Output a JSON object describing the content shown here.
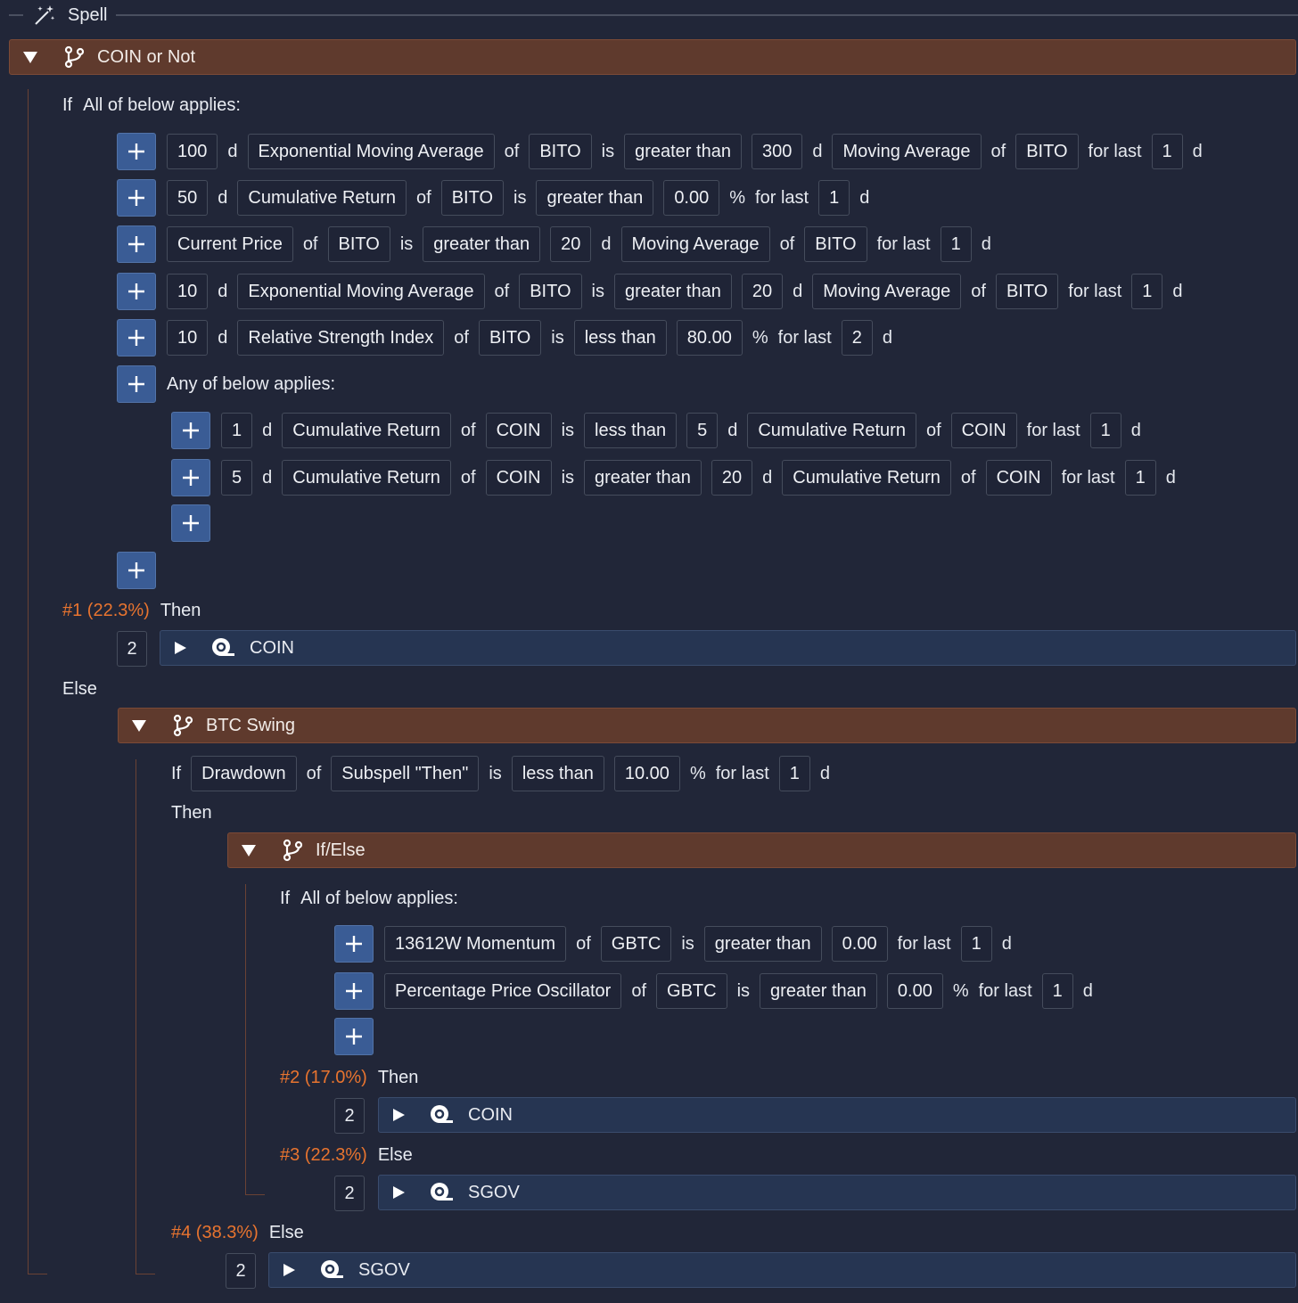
{
  "top": {
    "title": "Spell",
    "icon": "magic-wand-icon"
  },
  "main": {
    "header": "COIN or Not",
    "if_label": "If",
    "all_label": "All of below applies:",
    "rows": [
      [
        "100",
        "d",
        "Exponential Moving Average",
        "of",
        "BITO",
        "is",
        "greater than",
        "300",
        "d",
        "Moving Average",
        "of",
        "BITO",
        "for last",
        "1",
        "d"
      ],
      [
        "50",
        "d",
        "Cumulative Return",
        "of",
        "BITO",
        "is",
        "greater than",
        "0.00",
        "%",
        "for last",
        "1",
        "d"
      ],
      [
        "Current Price",
        "of",
        "BITO",
        "is",
        "greater than",
        "20",
        "d",
        "Moving Average",
        "of",
        "BITO",
        "for last",
        "1",
        "d"
      ],
      [
        "10",
        "d",
        "Exponential Moving Average",
        "of",
        "BITO",
        "is",
        "greater than",
        "20",
        "d",
        "Moving Average",
        "of",
        "BITO",
        "for last",
        "1",
        "d"
      ],
      [
        "10",
        "d",
        "Relative Strength Index",
        "of",
        "BITO",
        "is",
        "less than",
        "80.00",
        "%",
        "for last",
        "2",
        "d"
      ]
    ],
    "any_label": "Any of below applies:",
    "any_rows": [
      [
        "1",
        "d",
        "Cumulative Return",
        "of",
        "COIN",
        "is",
        "less than",
        "5",
        "d",
        "Cumulative Return",
        "of",
        "COIN",
        "for last",
        "1",
        "d"
      ],
      [
        "5",
        "d",
        "Cumulative Return",
        "of",
        "COIN",
        "is",
        "greater than",
        "20",
        "d",
        "Cumulative Return",
        "of",
        "COIN",
        "for last",
        "1",
        "d"
      ]
    ],
    "then1": {
      "pct": "#1 (22.3%)",
      "label": "Then",
      "weight": "2",
      "ticker": "COIN"
    },
    "else_label": "Else"
  },
  "btc": {
    "header": "BTC Swing",
    "if_label": "If",
    "cond": [
      "Drawdown",
      "of",
      "Subspell \"Then\"",
      "is",
      "less than",
      "10.00",
      "%",
      "for last",
      "1",
      "d"
    ],
    "then_label": "Then",
    "else4": {
      "pct": "#4 (38.3%)",
      "label": "Else",
      "weight": "2",
      "ticker": "SGOV"
    }
  },
  "ifelse": {
    "header": "If/Else",
    "if_label": "If",
    "all_label": "All of below applies:",
    "rows": [
      [
        "13612W Momentum",
        "of",
        "GBTC",
        "is",
        "greater than",
        "0.00",
        "for last",
        "1",
        "d"
      ],
      [
        "Percentage Price Oscillator",
        "of",
        "GBTC",
        "is",
        "greater than",
        "0.00",
        "%",
        "for last",
        "1",
        "d"
      ]
    ],
    "then2": {
      "pct": "#2 (17.0%)",
      "label": "Then",
      "weight": "2",
      "ticker": "COIN"
    },
    "else3": {
      "pct": "#3 (22.3%)",
      "label": "Else",
      "weight": "2",
      "ticker": "SGOV"
    }
  },
  "colors": {
    "bg": "#212638",
    "header": "#5f3a2d",
    "accent": "#e8742f",
    "plus": "#3a5c95",
    "asset": "#263552"
  }
}
